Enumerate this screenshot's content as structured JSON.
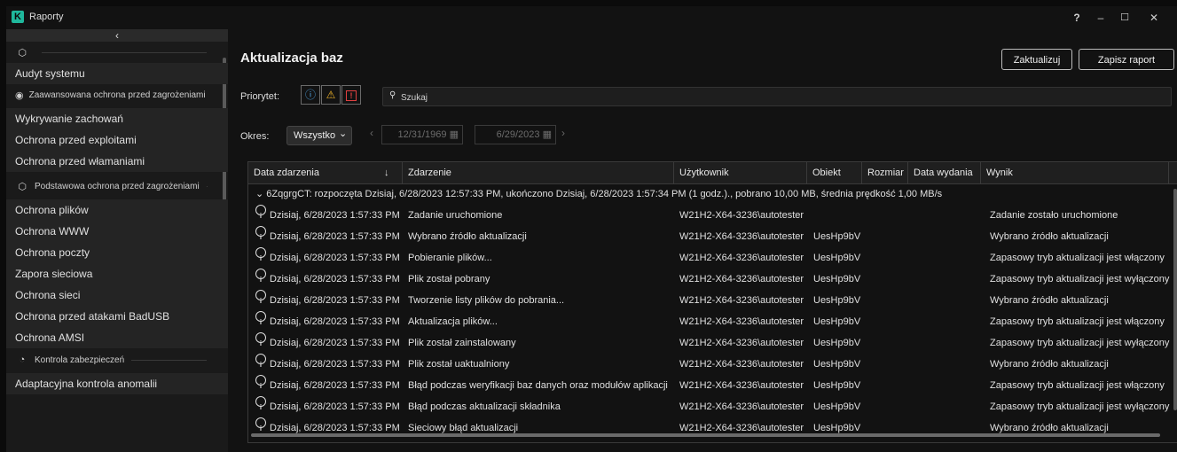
{
  "app": {
    "title": "Raporty",
    "logo_letter": "K",
    "accent_color": "#1fb89c"
  },
  "window_controls": {
    "help": "?",
    "minimize": "–",
    "maximize": "☐",
    "close": "✕"
  },
  "sidebar": {
    "collapse_glyph": "‹",
    "items": [
      {
        "kind": "section",
        "label": "",
        "icon": "shield-outline-icon",
        "glyph": "⬡"
      },
      {
        "kind": "item",
        "label": "Audyt systemu"
      },
      {
        "kind": "section",
        "label": "Zaawansowana ochrona przed zagrożeniami",
        "icon": "shield-filled-icon",
        "glyph": "◉"
      },
      {
        "kind": "item",
        "label": "Wykrywanie zachowań"
      },
      {
        "kind": "item",
        "label": "Ochrona przed exploitami"
      },
      {
        "kind": "item",
        "label": "Ochrona przed włamaniami"
      },
      {
        "kind": "section",
        "label": "Podstawowa ochrona przed zagrożeniami",
        "icon": "shield-outline-icon",
        "glyph": "⬡"
      },
      {
        "kind": "item",
        "label": "Ochrona plików"
      },
      {
        "kind": "item",
        "label": "Ochrona WWW"
      },
      {
        "kind": "item",
        "label": "Ochrona poczty"
      },
      {
        "kind": "item",
        "label": "Zapora sieciowa"
      },
      {
        "kind": "item",
        "label": "Ochrona sieci"
      },
      {
        "kind": "item",
        "label": "Ochrona przed atakami BadUSB"
      },
      {
        "kind": "item",
        "label": "Ochrona AMSI"
      },
      {
        "kind": "section",
        "label": "Kontrola zabezpieczeń",
        "icon": "control-icon",
        "glyph": "◔"
      },
      {
        "kind": "item",
        "label": "Adaptacyjna kontrola anomalii"
      }
    ]
  },
  "header": {
    "title": "Aktualizacja baz",
    "update_button": "Zaktualizuj",
    "save_report_button": "Zapisz raport"
  },
  "filters": {
    "priority_label": "Priorytet:",
    "priority_buttons": [
      {
        "name": "info",
        "glyph": "ⓘ",
        "color": "#4fa3e0"
      },
      {
        "name": "warning",
        "glyph": "⚠",
        "color": "#f0b429"
      },
      {
        "name": "critical",
        "glyph": "!",
        "color": "#e04040"
      }
    ],
    "search_placeholder": "Szukaj",
    "search_glyph": "⚲",
    "period_label": "Okres:",
    "period_value": "Wszystko",
    "period_chevron": "⌄",
    "date_from": "12/31/1969",
    "date_to": "6/29/2023",
    "prev_glyph": "‹",
    "next_glyph": "›",
    "calendar_glyph": "▦"
  },
  "table": {
    "sort_glyph": "↓",
    "columns": [
      "Data zdarzenia",
      "Zdarzenie",
      "Użytkownik",
      "Obiekt",
      "Rozmiar",
      "Data wydania",
      "Wynik"
    ],
    "group_row": "⌄  6ZqgrgCT: rozpoczęta Dzisiaj, 6/28/2023 12:57:33 PM, ukończono Dzisiaj, 6/28/2023 1:57:34 PM (1 godz.)., pobrano 10,00 MB, średnia prędkość 1,00 MB/s",
    "rows": [
      {
        "date": "Dzisiaj, 6/28/2023 1:57:33 PM",
        "event": "Zadanie uruchomione",
        "user": "W21H2-X64-3236\\autotester",
        "object": "",
        "result": "Zadanie zostało uruchomione"
      },
      {
        "date": "Dzisiaj, 6/28/2023 1:57:33 PM",
        "event": "Wybrano źródło aktualizacji",
        "user": "W21H2-X64-3236\\autotester",
        "object": "UesHp9bV",
        "result": "Wybrano źródło aktualizacji"
      },
      {
        "date": "Dzisiaj, 6/28/2023 1:57:33 PM",
        "event": "Pobieranie plików...",
        "user": "W21H2-X64-3236\\autotester",
        "object": "UesHp9bV",
        "result": "Zapasowy tryb aktualizacji jest włączony"
      },
      {
        "date": "Dzisiaj, 6/28/2023 1:57:33 PM",
        "event": "Plik został pobrany",
        "user": "W21H2-X64-3236\\autotester",
        "object": "UesHp9bV",
        "result": "Zapasowy tryb aktualizacji jest wyłączony"
      },
      {
        "date": "Dzisiaj, 6/28/2023 1:57:33 PM",
        "event": "Tworzenie listy plików do pobrania...",
        "user": "W21H2-X64-3236\\autotester",
        "object": "UesHp9bV",
        "result": "Wybrano źródło aktualizacji"
      },
      {
        "date": "Dzisiaj, 6/28/2023 1:57:33 PM",
        "event": "Aktualizacja plików...",
        "user": "W21H2-X64-3236\\autotester",
        "object": "UesHp9bV",
        "result": "Zapasowy tryb aktualizacji jest włączony"
      },
      {
        "date": "Dzisiaj, 6/28/2023 1:57:33 PM",
        "event": "Plik został zainstalowany",
        "user": "W21H2-X64-3236\\autotester",
        "object": "UesHp9bV",
        "result": "Zapasowy tryb aktualizacji jest wyłączony"
      },
      {
        "date": "Dzisiaj, 6/28/2023 1:57:33 PM",
        "event": "Plik został uaktualniony",
        "user": "W21H2-X64-3236\\autotester",
        "object": "UesHp9bV",
        "result": "Wybrano źródło aktualizacji"
      },
      {
        "date": "Dzisiaj, 6/28/2023 1:57:33 PM",
        "event": "Błąd podczas weryfikacji baz danych oraz modułów aplikacji",
        "user": "W21H2-X64-3236\\autotester",
        "object": "UesHp9bV",
        "result": "Zapasowy tryb aktualizacji jest włączony"
      },
      {
        "date": "Dzisiaj, 6/28/2023 1:57:33 PM",
        "event": "Błąd podczas aktualizacji składnika",
        "user": "W21H2-X64-3236\\autotester",
        "object": "UesHp9bV",
        "result": "Zapasowy tryb aktualizacji jest wyłączony"
      },
      {
        "date": "Dzisiaj, 6/28/2023 1:57:33 PM",
        "event": "Sieciowy błąd aktualizacji",
        "user": "W21H2-X64-3236\\autotester",
        "object": "UesHp9bV",
        "result": "Wybrano źródło aktualizacji"
      }
    ]
  }
}
